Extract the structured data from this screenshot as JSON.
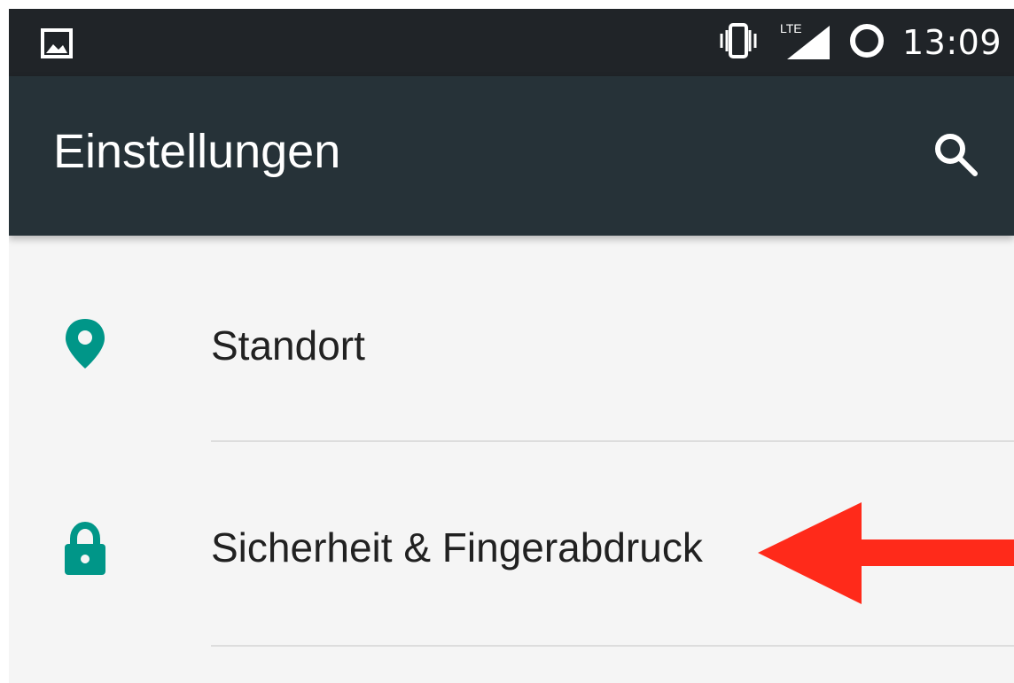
{
  "status_bar": {
    "time": "13:09",
    "network_label": "LTE",
    "icons": [
      "image-notification-icon",
      "vibrate-icon",
      "lte-signal-icon",
      "sync-circle-icon"
    ]
  },
  "toolbar": {
    "title": "Einstellungen",
    "search_icon": "search-icon",
    "background_color": "#263238"
  },
  "settings": {
    "items": [
      {
        "label": "Standort",
        "icon": "location-icon",
        "icon_color": "#009688"
      },
      {
        "label": "Sicherheit & Fingerabdruck",
        "icon": "lock-icon",
        "icon_color": "#009688"
      }
    ]
  },
  "annotation": {
    "type": "arrow",
    "color": "#ff2a1a"
  }
}
